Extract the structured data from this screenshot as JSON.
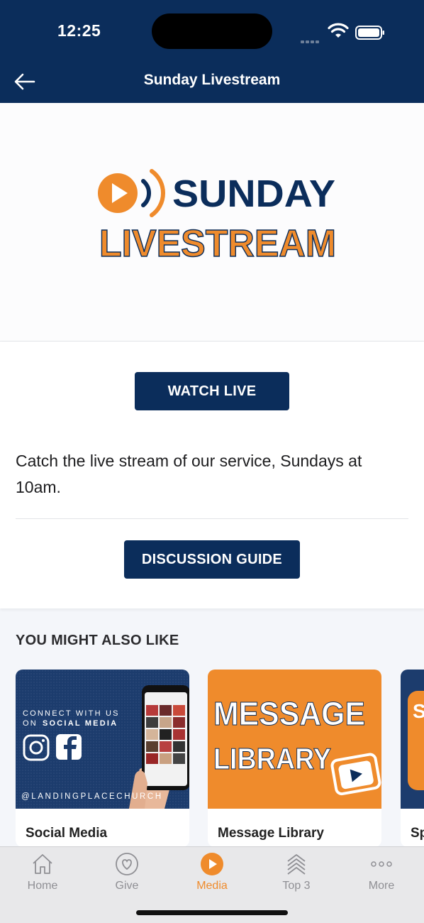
{
  "status": {
    "time": "12:25"
  },
  "header": {
    "title": "Sunday Livestream"
  },
  "hero": {
    "line1": "SUNDAY",
    "line2": "LIVESTREAM"
  },
  "content": {
    "watch_label": "WATCH LIVE",
    "description": "Catch the live stream of our service, Sundays at 10am.",
    "guide_label": "DISCUSSION GUIDE"
  },
  "related": {
    "title": "YOU MIGHT ALSO LIKE",
    "cards": [
      {
        "title": "Social Media",
        "image_text_1": "CONNECT WITH US",
        "image_text_2": "ON",
        "image_text_3": "SOCIAL MEDIA",
        "image_handle": "@LANDINGPLACECHURCH"
      },
      {
        "title": "Message Library",
        "image_text_1": "MESSAGE",
        "image_text_2": "LIBRARY"
      },
      {
        "title": "Sp",
        "image_text_1": "S"
      }
    ]
  },
  "tabs": [
    {
      "label": "Home",
      "icon": "home-icon"
    },
    {
      "label": "Give",
      "icon": "heart-icon"
    },
    {
      "label": "Media",
      "icon": "play-icon"
    },
    {
      "label": "Top 3",
      "icon": "layers-icon"
    },
    {
      "label": "More",
      "icon": "more-icon"
    }
  ],
  "colors": {
    "navy": "#0b2d5b",
    "orange": "#ef8b2c"
  }
}
